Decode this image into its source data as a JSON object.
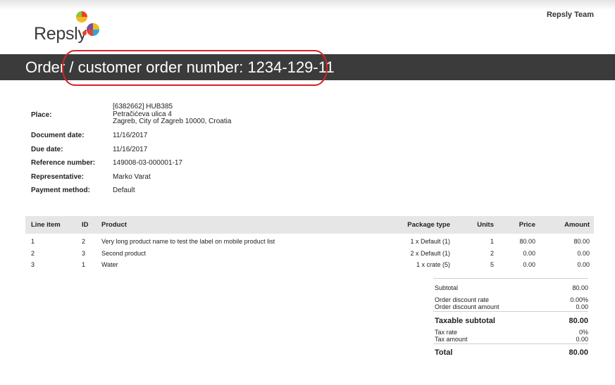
{
  "brand": {
    "logo_text": "Repsly",
    "team": "Repsly Team"
  },
  "header": {
    "title": "Order / customer order number: 1234-129-11"
  },
  "info": {
    "place_label": "Place:",
    "place_lines": [
      "[6382662] HUB385",
      "Petračićeva ulica 4",
      "Zagreb, City of Zagreb 10000, Croatia"
    ],
    "document_date_label": "Document date:",
    "document_date": "11/16/2017",
    "due_date_label": "Due date:",
    "due_date": "11/16/2017",
    "reference_label": "Reference number:",
    "reference": "149008-03-000001-17",
    "representative_label": "Representative:",
    "representative": "Marko Varat",
    "payment_label": "Payment method:",
    "payment": "Default"
  },
  "table": {
    "headers": {
      "line": "Line item",
      "id": "ID",
      "product": "Product",
      "package": "Package type",
      "units": "Units",
      "price": "Price",
      "amount": "Amount"
    },
    "rows": [
      {
        "line": "1",
        "id": "2",
        "product": "Very long product name to test the label on mobile product list",
        "package": "1 x Default (1)",
        "units": "1",
        "price": "80.00",
        "amount": "80.00"
      },
      {
        "line": "2",
        "id": "3",
        "product": "Second product",
        "package": "2 x Default (1)",
        "units": "2",
        "price": "0.00",
        "amount": "0.00"
      },
      {
        "line": "3",
        "id": "1",
        "product": "Water",
        "package": "1 x crate (5)",
        "units": "5",
        "price": "0.00",
        "amount": "0.00"
      }
    ]
  },
  "totals": {
    "subtotal_label": "Subtotal",
    "subtotal": "80.00",
    "discount_rate_label": "Order discount rate",
    "discount_rate": "0.00%",
    "discount_amount_label": "Order discount amount",
    "discount_amount": "0.00",
    "taxable_label": "Taxable subtotal",
    "taxable": "80.00",
    "tax_rate_label": "Tax rate",
    "tax_rate": "0%",
    "tax_amount_label": "Tax amount",
    "tax_amount": "0.00",
    "total_label": "Total",
    "total": "80.00"
  },
  "colors": {
    "header_bar": "#3b3b3b",
    "highlight": "#d6232a"
  }
}
